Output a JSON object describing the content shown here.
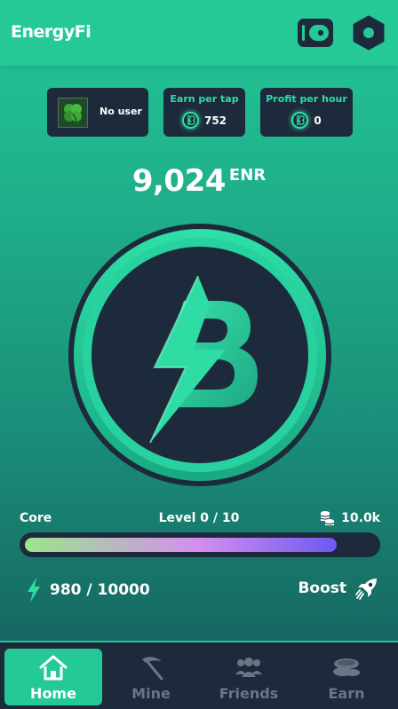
{
  "app": {
    "title": "EnergyFi"
  },
  "stats": {
    "user_label": "No user",
    "earn_per_tap_label": "Earn per tap",
    "earn_per_tap_value": "752",
    "profit_per_hour_label": "Profit per hour",
    "profit_per_hour_value": "0"
  },
  "balance": {
    "value": "9,024",
    "unit": "ENR"
  },
  "core": {
    "label": "Core",
    "level_text": "Level 0 / 10",
    "capacity": "10.0k",
    "progress_fraction": 0.89
  },
  "energy": {
    "text": "980 / 10000"
  },
  "boost": {
    "label": "Boost"
  },
  "nav": {
    "tabs": [
      {
        "label": "Home",
        "icon": "home-icon",
        "active": true
      },
      {
        "label": "Mine",
        "icon": "pickaxe-icon",
        "active": false
      },
      {
        "label": "Friends",
        "icon": "friends-icon",
        "active": false
      },
      {
        "label": "Earn",
        "icon": "coins-icon",
        "active": false
      }
    ]
  },
  "colors": {
    "accent": "#25c998",
    "card": "#1d2a3c",
    "coin_glow": "#2fdca4"
  }
}
